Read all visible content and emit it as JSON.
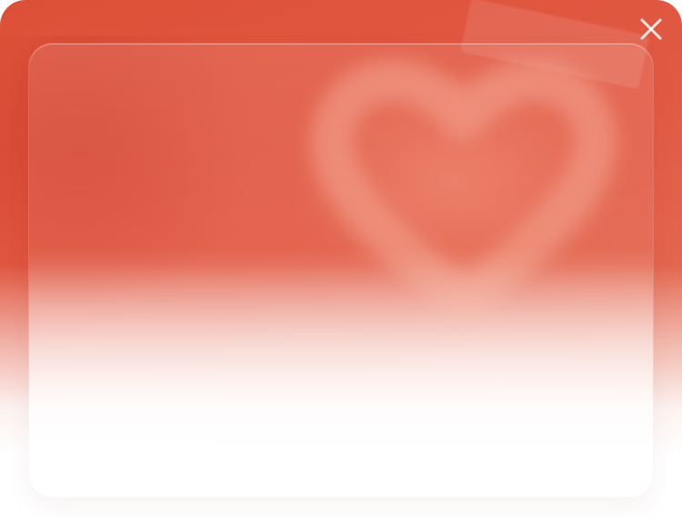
{
  "app": {
    "accent_color": "#e25a44",
    "close_icon": "close-icon"
  },
  "dialog": {
    "close_label": "Close"
  }
}
